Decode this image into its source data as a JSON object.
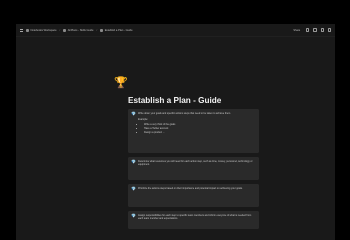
{
  "topbar": {
    "breadcrumbs": [
      "Notebooks Workspace",
      "AI/Plans - Skills Guide",
      "Establish a Plan - Guide"
    ],
    "share_label": "Share",
    "icons": [
      "comment-icon",
      "clock-icon",
      "star-icon",
      "more-icon"
    ]
  },
  "page": {
    "icon": "🏆",
    "title": "Establish a Plan - Guide"
  },
  "callouts": [
    {
      "icon": "💎",
      "text": "Write down your goals and specific actions steps that need to be taken to achieve them.",
      "example_label": "Example:",
      "bullets": [
        "Write a very thick of the goals",
        "Have a Twitter account",
        "Design a product ..."
      ]
    },
    {
      "icon": "💎",
      "text": "Determine what resources you will need for each action step, such as time, money, personnel, technology or equipment."
    },
    {
      "icon": "💎",
      "text": "Prioritize the actions steps based on their importance and potential impact on achieving your goals."
    },
    {
      "icon": "💎",
      "text": "Assign responsibilities for each step to specific team members and inform everyone of what is needed from each team member and expectations."
    }
  ]
}
